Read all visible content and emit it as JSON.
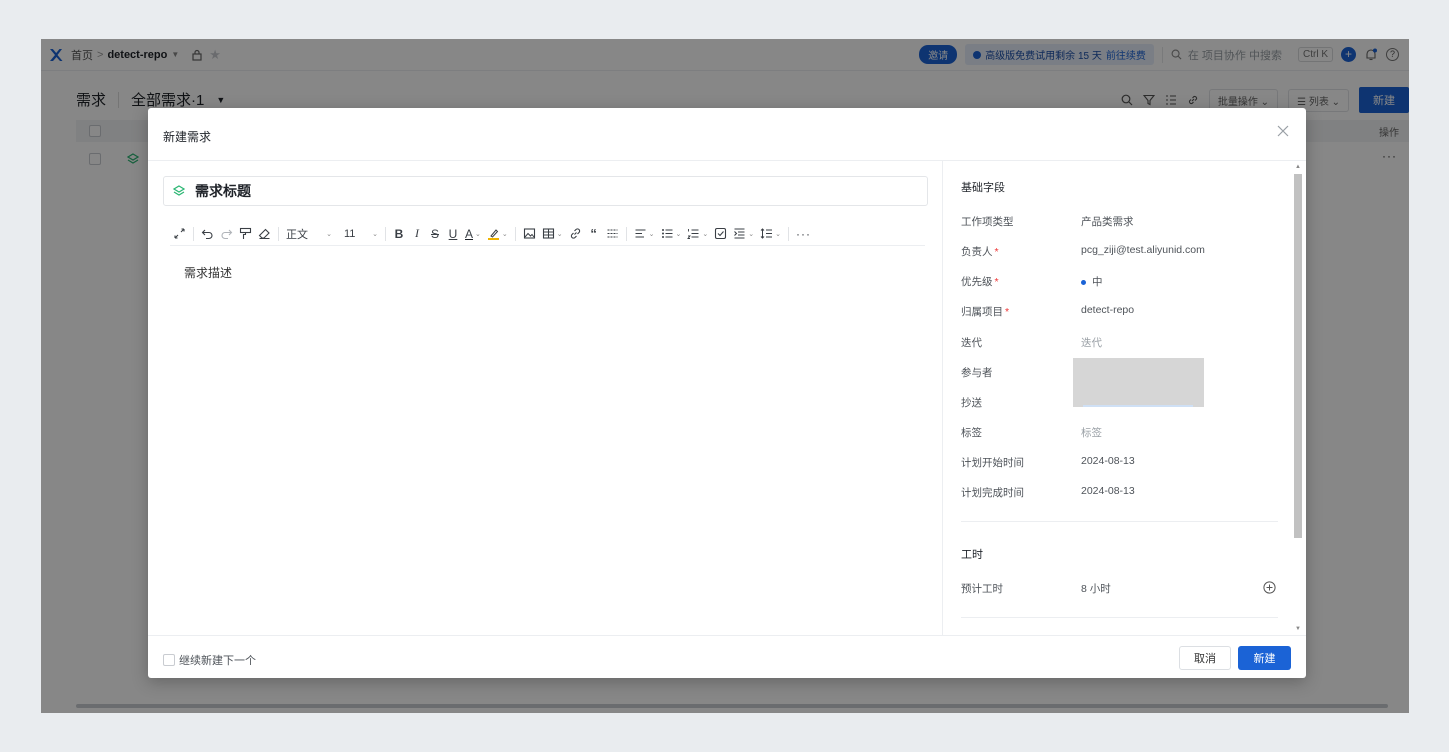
{
  "topbar": {
    "breadcrumb_home": "首页",
    "breadcrumb_sep": ">",
    "repo": "detect-repo",
    "invite": "邀请",
    "trial_text": "高级版免费试用剩余 15 天",
    "trial_link": "前往续费",
    "search_placeholder": "在 项目协作 中搜索",
    "shortcut": "Ctrl K"
  },
  "subheader": {
    "title": "需求",
    "view": "全部需求·1",
    "batch": "批量操作",
    "list_view": "列表",
    "new": "新建",
    "column_ops": "操作",
    "row_more": "···"
  },
  "modal": {
    "title": "新建需求",
    "title_placeholder": "需求标题",
    "editor_placeholder": "需求描述",
    "toolbar": {
      "paragraph": "正文",
      "font_size": "11"
    },
    "basic_section": "基础字段",
    "fields": {
      "type_label": "工作项类型",
      "type_value": "产品类需求",
      "assignee_label": "负责人",
      "assignee_value": "pcg_ziji@test.aliyunid.com",
      "priority_label": "优先级",
      "priority_value": "中",
      "project_label": "归属项目",
      "project_value": "detect-repo",
      "iteration_label": "迭代",
      "iteration_value": "迭代",
      "participants_label": "参与者",
      "cc_label": "抄送",
      "tags_label": "标签",
      "tags_value": "标签",
      "start_label": "计划开始时间",
      "start_value": "2024-08-13",
      "end_label": "计划完成时间",
      "end_value": "2024-08-13"
    },
    "required_mark": "*",
    "hours_section": "工时",
    "estimate_label": "预计工时",
    "estimate_value": "8 小时",
    "continue_label": "继续新建下一个",
    "cancel": "取消",
    "create": "新建"
  },
  "colors": {
    "primary": "#1b63d6",
    "required": "#e33333"
  }
}
